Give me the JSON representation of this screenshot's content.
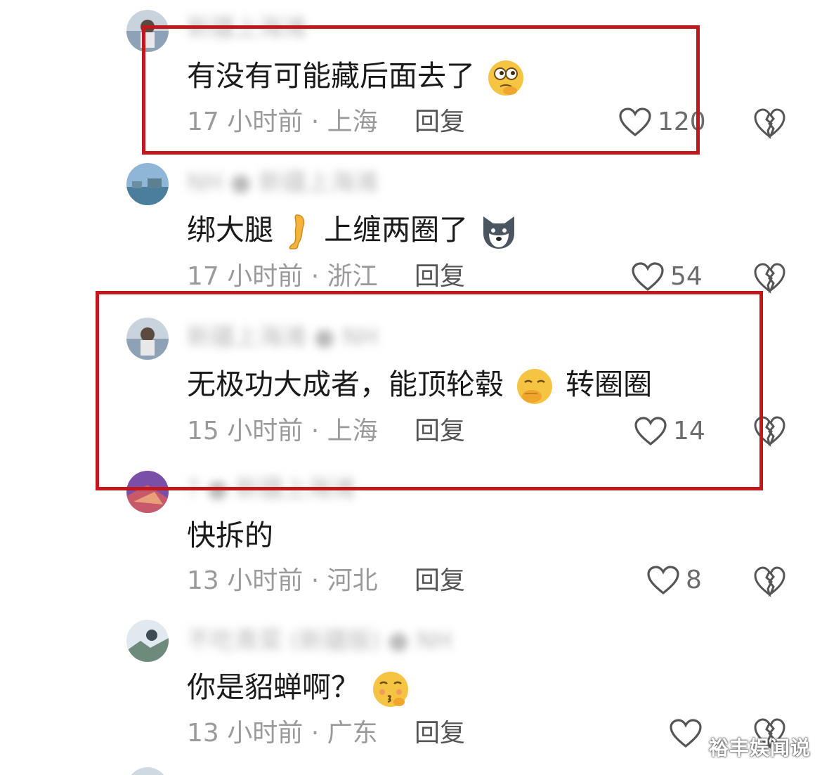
{
  "comments": [
    {
      "username": "新疆上海滩",
      "body_text": "有没有可能藏后面去了",
      "meta": "17 小时前 · 上海",
      "reply_label": "回复",
      "like_count": "120"
    },
    {
      "username": "NH ● 新疆上海滩",
      "body_text_1": "绑大腿",
      "body_text_2": "上缠两圈了",
      "meta": "17 小时前 · 浙江",
      "reply_label": "回复",
      "like_count": "54"
    },
    {
      "username": "新疆上海滩 ● NH",
      "body_text_1": "无极功大成者，能顶轮毂",
      "body_text_2": "转圈圈",
      "meta": "15 小时前 · 上海",
      "reply_label": "回复",
      "like_count": "14"
    },
    {
      "username": "? ● 新疆上海滩",
      "body_text": "快拆的",
      "meta": "13 小时前 · 河北",
      "reply_label": "回复",
      "like_count": "8"
    },
    {
      "username": "不吃青菜 (新疆版) ● NH",
      "body_text": "你是貂蝉啊？",
      "meta": "13 小时前 · 广东",
      "reply_label": "回复",
      "like_count": ""
    }
  ],
  "watermark": "裕丰娱闻说",
  "icons": {
    "like": "heart-outline-icon",
    "dislike": "broken-heart-icon"
  },
  "colors": {
    "highlight": "#c0181c",
    "meta_text": "#9a9a9a",
    "body_text": "#1a1a1a"
  }
}
